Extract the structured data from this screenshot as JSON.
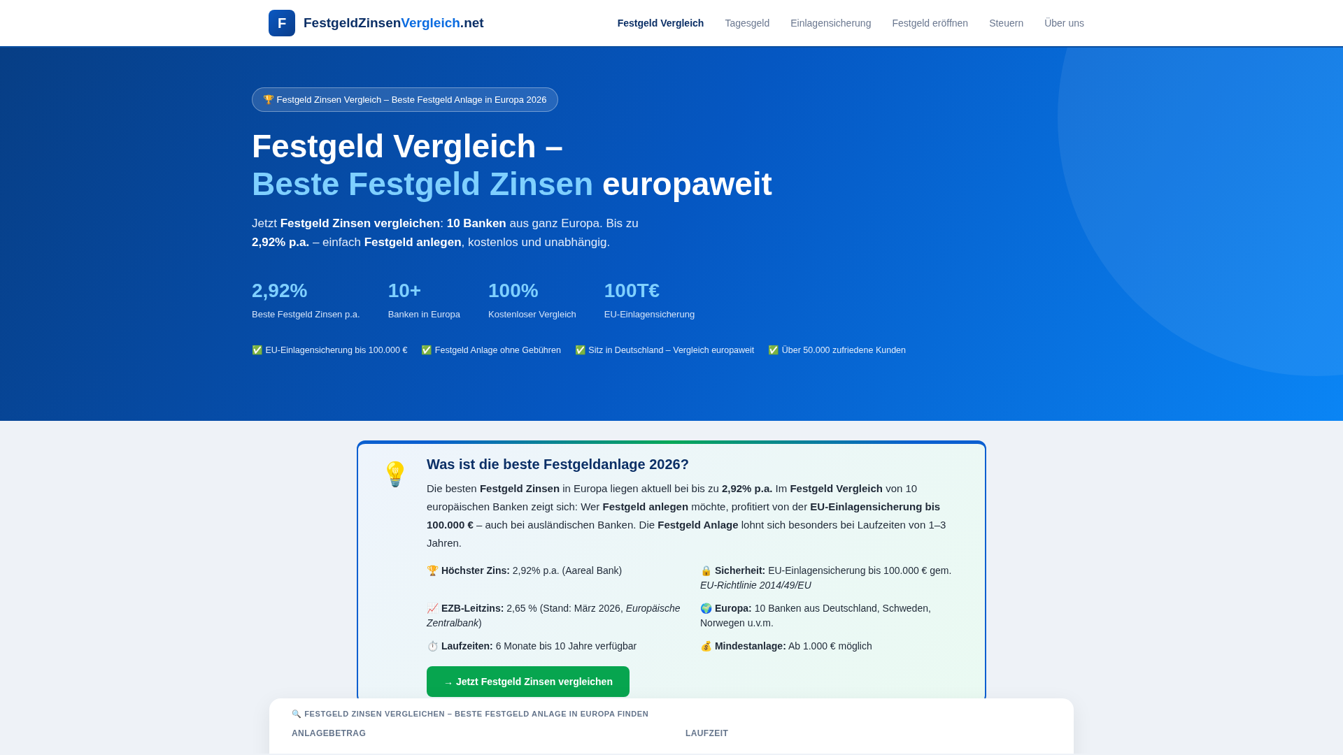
{
  "header": {
    "logo": {
      "letter": "F",
      "parts": [
        "FestgeldZinsen",
        "Vergleich",
        ".net"
      ]
    },
    "nav": [
      {
        "label": "Festgeld Vergleich",
        "selected": true
      },
      {
        "label": "Tagesgeld",
        "selected": false
      },
      {
        "label": "Einlagensicherung",
        "selected": false
      },
      {
        "label": "Festgeld eröffnen",
        "selected": false
      },
      {
        "label": "Steuern",
        "selected": false
      },
      {
        "label": "Über uns",
        "selected": false
      }
    ]
  },
  "hero": {
    "badge": "🏆 Festgeld Zinsen Vergleich – Beste Festgeld Anlage in Europa 2026",
    "title": {
      "line1": "Festgeld Vergleich –",
      "highlight": "Beste Festgeld Zinsen",
      "rest": "europaweit"
    },
    "subtitle": "Jetzt **Festgeld Zinsen vergleichen**: **10 Banken** aus ganz Europa. Bis zu **2,92% p.a.** – einfach **Festgeld anlegen**, kostenlos und unabhängig.",
    "stats": [
      {
        "value": "2,92%",
        "label": "Beste Festgeld Zinsen p.a."
      },
      {
        "value": "10+",
        "label": "Banken in Europa"
      },
      {
        "value": "100%",
        "label": "Kostenloser Vergleich"
      },
      {
        "value": "100T€",
        "label": "EU-Einlagensicherung"
      }
    ],
    "trust": [
      "✅ EU-Einlagensicherung bis 100.000 €",
      "✅ Festgeld Anlage ohne Gebühren",
      "✅ Sitz in Deutschland – Vergleich europaweit",
      "✅ Über 50.000 zufriedene Kunden"
    ]
  },
  "info_card": {
    "icon": "💡",
    "title": "Was ist die beste Festgeldanlage 2026?",
    "text": "Die besten **Festgeld Zinsen** in Europa liegen aktuell bei bis zu **2,92% p.a.** Im **Festgeld Vergleich** von 10 europäischen Banken zeigt sich: Wer **Festgeld anlegen** möchte, profitiert von der **EU-Einlagensicherung bis 100.000 €** – auch bei ausländischen Banken. Die **Festgeld Anlage** lohnt sich besonders bei Laufzeiten von 1–3 Jahren.",
    "facts": [
      "🏆 **Höchster Zins:** 2,92% p.a. (Aareal Bank)",
      "🔒 **Sicherheit:** EU-Einlagensicherung bis 100.000 € gem. *EU-Richtlinie 2014/49/EU*",
      "📈 **EZB-Leitzins:** 2,65 % (Stand: März 2026, *Europäische Zentralbank*)",
      "🌍 **Europa:** 10 Banken aus Deutschland, Schweden, Norwegen u.v.m.",
      "⏱️ **Laufzeiten:** 6 Monate bis 10 Jahre verfügbar",
      "💰 **Mindestanlage:** Ab 1.000 € möglich"
    ],
    "button": "→ Jetzt Festgeld Zinsen vergleichen"
  },
  "search_panel": {
    "title": "🔍 FESTGELD ZINSEN VERGLEICHEN – BESTE FESTGELD ANLAGE IN EUROPA FINDEN",
    "fields": [
      "ANLAGEBETRAG",
      "LAUFZEIT"
    ]
  }
}
